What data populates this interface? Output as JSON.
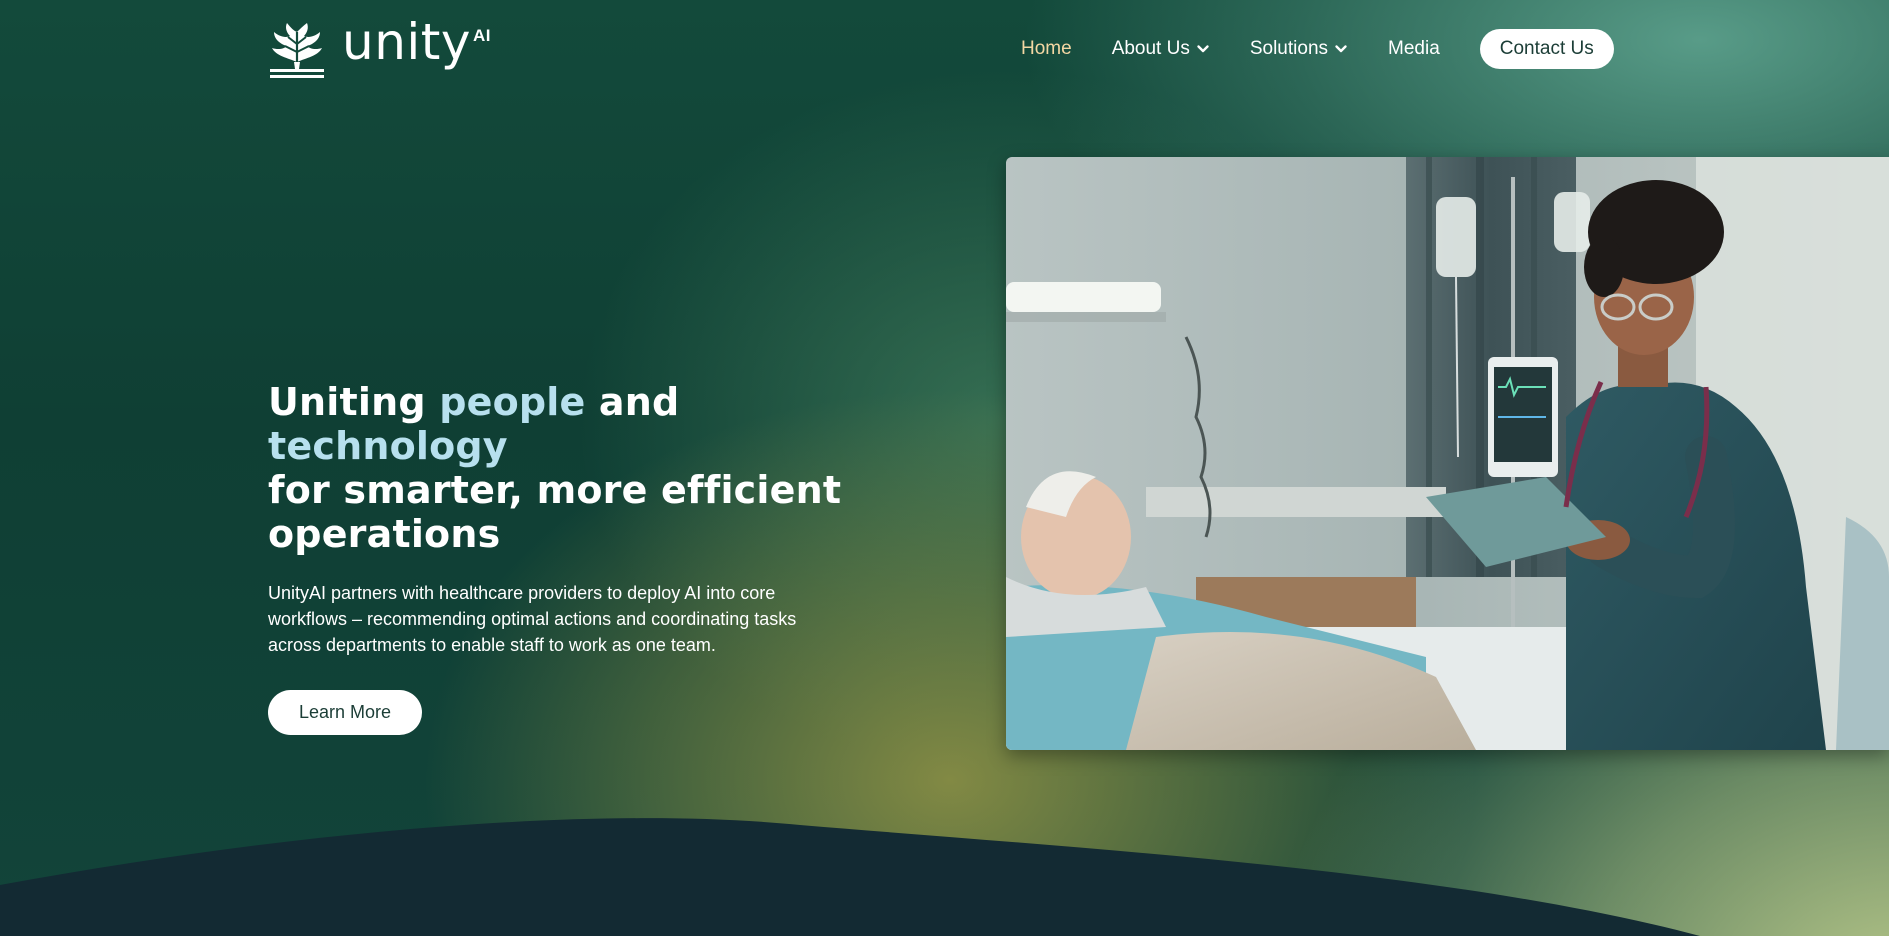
{
  "brand": {
    "name": "unity",
    "superscript": "AI"
  },
  "nav": {
    "items": [
      {
        "label": "Home",
        "active": true,
        "has_dropdown": false
      },
      {
        "label": "About Us",
        "active": false,
        "has_dropdown": true
      },
      {
        "label": "Solutions",
        "active": false,
        "has_dropdown": true
      },
      {
        "label": "Media",
        "active": false,
        "has_dropdown": false
      }
    ],
    "contact_label": "Contact Us"
  },
  "hero": {
    "title_part1": "Uniting ",
    "title_highlight1": "people",
    "title_part2": " and ",
    "title_highlight2": "technology",
    "title_part3": "for smarter, more efficient operations",
    "description": "UnityAI partners with healthcare providers to deploy AI into core workflows – recommending optimal actions and coordinating tasks across departments to enable staff to work as one team.",
    "cta_label": "Learn More"
  },
  "colors": {
    "accent_highlight": "#b7e0ee",
    "nav_active": "#f3d7a3",
    "dark_wave": "#132a33",
    "button_text": "#1b3d36"
  },
  "icons": {
    "logo": "tree-logo-icon",
    "dropdown": "chevron-down-icon"
  }
}
